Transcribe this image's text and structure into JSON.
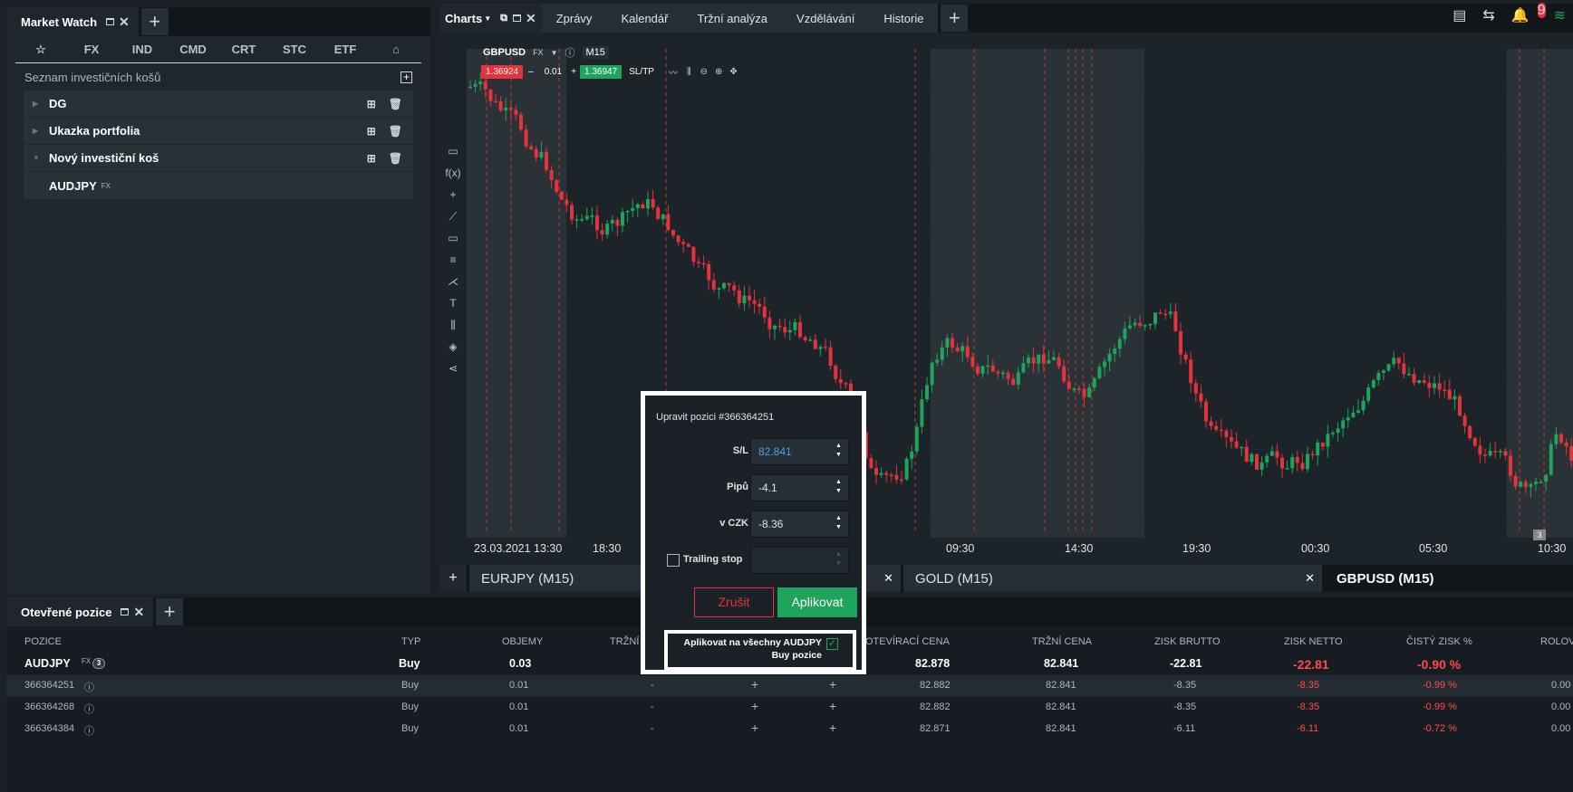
{
  "market_watch": {
    "title": "Market Watch",
    "filters": [
      "FX",
      "IND",
      "CMD",
      "CRT",
      "STC",
      "ETF"
    ],
    "basket_title": "Seznam investičních košů",
    "baskets": [
      {
        "label": "DG"
      },
      {
        "label": "Ukazka portfolia"
      },
      {
        "label": "Nový investiční koš"
      }
    ],
    "sub_item": {
      "label": "AUDJPY",
      "market": "FX"
    }
  },
  "charts_bar": {
    "tab": "Charts",
    "nav": [
      "Zprávy",
      "Kalendář",
      "Tržní analýza",
      "Vzdělávání",
      "Historie"
    ],
    "notif_count": "9"
  },
  "chart": {
    "symbol": "GBPUSD",
    "market": "FX",
    "timeframe": "M15",
    "bid": "1.36924",
    "volume": "0.01",
    "ask": "1.36947",
    "sltp": "SL/TP",
    "x_labels": [
      "23.03.2021 13:30",
      "18:30",
      "09:30",
      "14:30",
      "19:30",
      "00:30",
      "05:30",
      "10:30"
    ],
    "event_badge": "3",
    "candle_colors": {
      "up": "#1fa45b",
      "down": "#e5323c"
    }
  },
  "bottom_tabs": [
    "EURJPY (M15)",
    "GOLD (M15)",
    "GBPUSD (M15)"
  ],
  "positions": {
    "title": "Otevřené pozice",
    "headers": [
      "POZICE",
      "TYP",
      "OBJEMY",
      "TRŽNÍ",
      "OTEVÍRACÍ CENA",
      "TRŽNÍ CENA",
      "ZISK BRUTTO",
      "ZISK NETTO",
      "ČISTÝ ZISK %",
      "ROLOVÁ"
    ],
    "group": {
      "symbol": "AUDJPY",
      "market": "FX",
      "count": "3",
      "type": "Buy",
      "volume": "0.03",
      "open": "82.878",
      "market_price": "82.841",
      "gross": "-22.81",
      "net": "-22.81",
      "pct": "-0.90 %"
    },
    "rows": [
      {
        "id": "366364251",
        "type": "Buy",
        "volume": "0.01",
        "dash": "-",
        "open": "82.882",
        "market_price": "82.841",
        "gross": "-8.35",
        "net": "-8.35",
        "pct": "-0.99 %",
        "roll": "0.00"
      },
      {
        "id": "366364268",
        "type": "Buy",
        "volume": "0.01",
        "dash": "-",
        "open": "82.882",
        "market_price": "82.841",
        "gross": "-8.35",
        "net": "-8.35",
        "pct": "-0.99 %",
        "roll": "0.00"
      },
      {
        "id": "366364384",
        "type": "Buy",
        "volume": "0.01",
        "dash": "-",
        "open": "82.871",
        "market_price": "82.841",
        "gross": "-6.11",
        "net": "-6.11",
        "pct": "-0.72 %",
        "roll": "0.00"
      }
    ]
  },
  "dialog": {
    "title": "Upravit pozici #366364251",
    "sl_label": "S/L",
    "sl_value": "82.841",
    "pips_label": "Pipů",
    "pips_value": "-4.1",
    "czk_label": "v CZK",
    "czk_value": "-8.36",
    "trailing_label": "Trailing stop",
    "cancel": "Zrušit",
    "apply": "Aplikovat",
    "apply_all": "Aplikovat na všechny AUDJPY Buy pozice"
  }
}
